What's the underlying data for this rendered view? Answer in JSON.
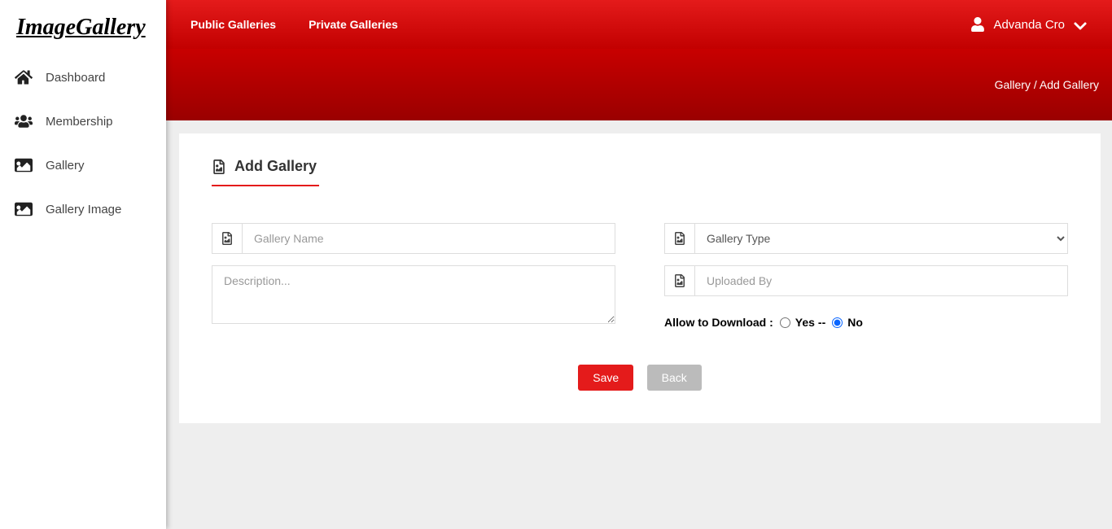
{
  "brand": "ImageGallery",
  "sidebar": {
    "items": [
      {
        "label": "Dashboard"
      },
      {
        "label": "Membership"
      },
      {
        "label": "Gallery"
      },
      {
        "label": "Gallery Image"
      }
    ]
  },
  "topnav": {
    "items": [
      {
        "label": "Public Galleries"
      },
      {
        "label": "Private Galleries"
      }
    ]
  },
  "user": {
    "name": "Advanda Cro"
  },
  "breadcrumb": "Gallery / Add Gallery",
  "page": {
    "title": "Add Gallery",
    "fields": {
      "name_placeholder": "Gallery Name",
      "desc_placeholder": "Description...",
      "type_placeholder": "Gallery Type",
      "uploaded_placeholder": "Uploaded By",
      "allow_label": "Allow to Download :",
      "yes_label": "Yes",
      "sep": "--",
      "no_label": "No"
    },
    "buttons": {
      "save": "Save",
      "back": "Back"
    }
  }
}
